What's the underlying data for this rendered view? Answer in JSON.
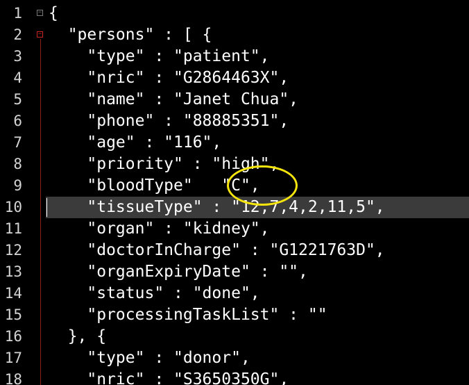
{
  "editor": {
    "lines": [
      {
        "num": "1",
        "text": "{"
      },
      {
        "num": "2",
        "text": "  \"persons\" : [ {"
      },
      {
        "num": "3",
        "text": "    \"type\" : \"patient\","
      },
      {
        "num": "4",
        "text": "    \"nric\" : \"G2864463X\","
      },
      {
        "num": "5",
        "text": "    \"name\" : \"Janet Chua\","
      },
      {
        "num": "6",
        "text": "    \"phone\" : \"88885351\","
      },
      {
        "num": "7",
        "text": "    \"age\" : \"116\","
      },
      {
        "num": "8",
        "text": "    \"priority\" : \"high\","
      },
      {
        "num": "9",
        "text": "    \"bloodType\"   \"C\","
      },
      {
        "num": "10",
        "text": "    \"tissueType\" : \"12,7,4,2,11,5\","
      },
      {
        "num": "11",
        "text": "    \"organ\" : \"kidney\","
      },
      {
        "num": "12",
        "text": "    \"doctorInCharge\" : \"G1221763D\","
      },
      {
        "num": "13",
        "text": "    \"organExpiryDate\" : \"\","
      },
      {
        "num": "14",
        "text": "    \"status\" : \"done\","
      },
      {
        "num": "15",
        "text": "    \"processingTaskList\" : \"\""
      },
      {
        "num": "16",
        "text": "  }, {"
      },
      {
        "num": "17",
        "text": "    \"type\" : \"donor\","
      },
      {
        "num": "18",
        "text": "    \"nric\" : \"S3650350G\","
      }
    ],
    "current_line": "10",
    "fold_collapse_glyph": "−",
    "colors": {
      "background": "#000000",
      "text": "#ffffff",
      "line_numbers": "#d4d4d4",
      "current_line": "#3b3b3b",
      "fold_marker": "#c8261c",
      "annotation_circle": "#f5e50c"
    }
  }
}
